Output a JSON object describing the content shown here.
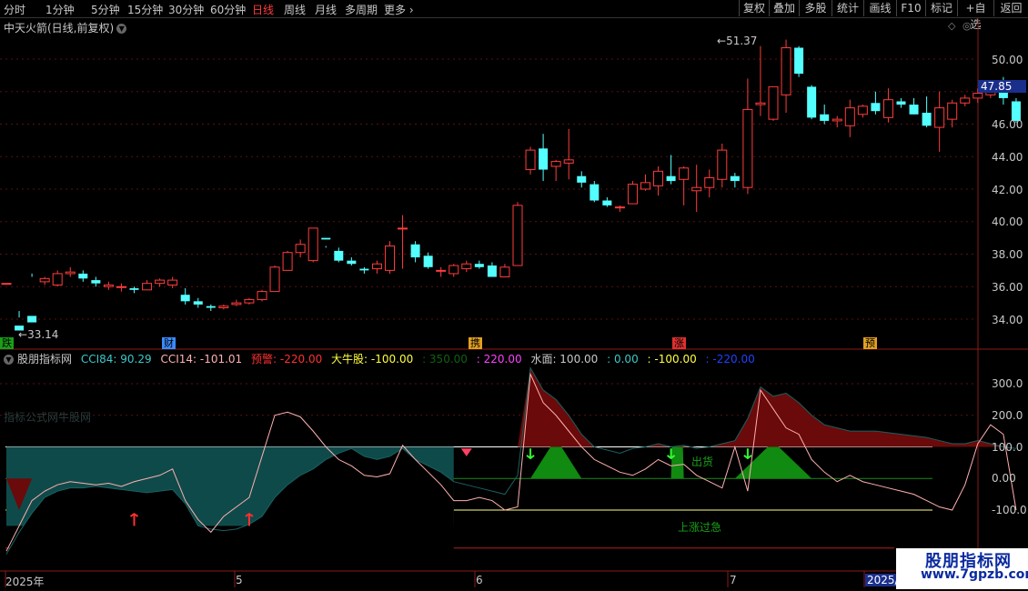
{
  "toolbar": {
    "tabs": [
      "分时",
      "1分钟",
      "5分钟",
      "15分钟",
      "30分钟",
      "60分钟",
      "日线",
      "周线",
      "月线",
      "多周期",
      "更多"
    ],
    "active_tab": "日线",
    "right_buttons": [
      "复权",
      "叠加",
      "多股",
      "统计",
      "画线",
      "F10",
      "标记",
      "+自选",
      "返回"
    ]
  },
  "chart_title": "中天火箭(日线,前复权)",
  "price_axis": [
    "50.00",
    "48.00",
    "46.00",
    "44.00",
    "42.00",
    "40.00",
    "38.00",
    "36.00",
    "34.00"
  ],
  "current_price": "47.85",
  "high_label": "51.37",
  "low_label": "33.14",
  "markers": [
    {
      "text": "跌",
      "color": "#18a018"
    },
    {
      "text": "财",
      "color": "#3a8cff"
    },
    {
      "text": "携",
      "color": "#e0a020"
    },
    {
      "text": "涨",
      "color": "#e03030"
    },
    {
      "text": "预",
      "color": "#e0a020"
    }
  ],
  "indicator": {
    "name": "股朋指标网",
    "values": [
      {
        "text": "CCI84: 90.29",
        "color": "#3cc8c8"
      },
      {
        "text": "CCI14: -101.01",
        "color": "#ffb0b0"
      },
      {
        "text": "预警: -220.00",
        "color": "#ff3030"
      },
      {
        "text": "大牛股: -100.00",
        "color": "#ffff40"
      },
      {
        "text": ": 350.00",
        "color": "#106010"
      },
      {
        "text": ": 220.00",
        "color": "#ff40ff"
      },
      {
        "text": "水面: 100.00",
        "color": "#c8c8c8"
      },
      {
        "text": ": 0.00",
        "color": "#3cc8c8"
      },
      {
        "text": ": -100.00",
        "color": "#ffff40"
      },
      {
        "text": ": -220.00",
        "color": "#2040ff"
      }
    ],
    "axis": [
      "300.0",
      "200.0",
      "100.0",
      "0.00",
      "-100.0"
    ],
    "faint_text": "指标公式网牛股网",
    "label_chuhuo": "出货",
    "label_guoji": "上涨过急"
  },
  "x_axis": [
    "2025年",
    "5",
    "6",
    "7",
    "2025/"
  ],
  "watermark": {
    "line1": "股朋指标网",
    "line2": "www.7gpzb.com"
  },
  "chart_data": {
    "type": "candlestick",
    "ylim": [
      33,
      52
    ],
    "candles": [
      [
        36.2,
        33.5,
        36.2,
        33.5
      ],
      [
        33.6,
        34.5,
        33.3,
        34.1
      ],
      [
        34.2,
        36.8,
        33.8,
        36.6
      ],
      [
        36.3,
        36.1,
        36.5,
        36.6
      ],
      [
        36.1,
        37.0,
        36.8,
        36.0
      ],
      [
        36.8,
        37.2,
        36.9,
        36.6
      ],
      [
        36.8,
        37.0,
        36.5,
        36.3
      ],
      [
        36.4,
        36.6,
        36.2,
        36.0
      ],
      [
        36.0,
        36.3,
        36.1,
        35.8
      ],
      [
        36.0,
        36.2,
        36.0,
        35.7
      ],
      [
        35.9,
        36.0,
        35.8,
        35.6
      ],
      [
        35.8,
        36.4,
        36.2,
        35.8
      ],
      [
        36.2,
        36.5,
        36.4,
        36.0
      ],
      [
        36.1,
        36.6,
        36.4,
        35.9
      ],
      [
        35.5,
        35.9,
        35.1,
        34.9
      ],
      [
        35.1,
        35.3,
        34.9,
        34.7
      ],
      [
        34.8,
        34.9,
        34.7,
        34.5
      ],
      [
        34.7,
        34.9,
        34.8,
        34.6
      ],
      [
        34.9,
        35.2,
        35.0,
        34.8
      ],
      [
        35.0,
        35.3,
        35.2,
        34.9
      ],
      [
        35.2,
        35.8,
        35.7,
        35.1
      ],
      [
        35.7,
        37.3,
        37.2,
        35.7
      ],
      [
        37.0,
        38.2,
        38.1,
        37.0
      ],
      [
        38.1,
        38.9,
        38.6,
        37.8
      ],
      [
        37.6,
        39.6,
        39.6,
        37.5
      ],
      [
        39.0,
        38.5,
        38.9,
        38.4
      ],
      [
        38.2,
        38.4,
        37.6,
        37.5
      ],
      [
        37.6,
        37.8,
        37.4,
        37.3
      ],
      [
        37.1,
        37.2,
        37.0,
        36.8
      ],
      [
        37.1,
        37.6,
        37.4,
        36.8
      ],
      [
        37.0,
        38.8,
        38.5,
        36.8
      ],
      [
        39.6,
        40.4,
        39.6,
        37.1
      ],
      [
        38.6,
        38.8,
        37.8,
        37.5
      ],
      [
        37.9,
        38.1,
        37.2,
        37.1
      ],
      [
        37.0,
        37.2,
        37.0,
        36.6
      ],
      [
        36.8,
        37.4,
        37.3,
        36.6
      ],
      [
        37.1,
        37.6,
        37.4,
        36.9
      ],
      [
        37.4,
        37.6,
        37.2,
        37.1
      ],
      [
        37.3,
        37.5,
        36.6,
        36.6
      ],
      [
        36.6,
        37.4,
        37.2,
        36.6
      ],
      [
        37.3,
        41.2,
        41.0,
        37.3
      ],
      [
        43.2,
        44.6,
        44.4,
        42.9
      ],
      [
        44.5,
        45.4,
        43.2,
        42.5
      ],
      [
        43.4,
        43.8,
        43.7,
        42.5
      ],
      [
        43.6,
        45.7,
        43.8,
        42.6
      ],
      [
        42.8,
        43.1,
        42.4,
        42.1
      ],
      [
        42.3,
        42.5,
        41.3,
        41.2
      ],
      [
        41.3,
        41.5,
        41.0,
        40.9
      ],
      [
        40.9,
        41.0,
        40.9,
        40.6
      ],
      [
        41.1,
        42.5,
        42.3,
        41.1
      ],
      [
        42.0,
        42.9,
        42.4,
        41.9
      ],
      [
        42.2,
        43.4,
        43.1,
        41.6
      ],
      [
        42.8,
        44.1,
        42.5,
        42.3
      ],
      [
        42.6,
        43.4,
        43.3,
        41.0
      ],
      [
        41.9,
        43.5,
        42.1,
        40.6
      ],
      [
        42.1,
        43.2,
        42.7,
        41.5
      ],
      [
        42.6,
        44.8,
        44.4,
        42.1
      ],
      [
        42.8,
        43.0,
        42.5,
        42.1
      ],
      [
        42.1,
        48.8,
        46.9,
        41.7
      ],
      [
        47.2,
        50.8,
        47.3,
        46.5
      ],
      [
        46.3,
        48.3,
        48.3,
        46.2
      ],
      [
        47.8,
        51.2,
        50.7,
        46.7
      ],
      [
        50.7,
        50.8,
        49.1,
        48.9
      ],
      [
        48.3,
        48.4,
        46.4,
        46.3
      ],
      [
        46.6,
        47.2,
        46.2,
        46.0
      ],
      [
        46.2,
        46.5,
        46.3,
        45.8
      ],
      [
        45.9,
        47.5,
        47.0,
        45.2
      ],
      [
        46.6,
        47.2,
        47.1,
        46.4
      ],
      [
        47.3,
        48.0,
        46.8,
        46.6
      ],
      [
        46.4,
        48.2,
        47.5,
        46.1
      ],
      [
        47.4,
        47.6,
        47.2,
        47.0
      ],
      [
        47.2,
        47.6,
        46.6,
        46.6
      ],
      [
        46.7,
        47.7,
        45.9,
        45.8
      ],
      [
        45.8,
        48.0,
        47.0,
        44.3
      ],
      [
        46.3,
        47.5,
        47.3,
        45.8
      ],
      [
        47.3,
        47.8,
        47.6,
        47.1
      ],
      [
        47.6,
        48.2,
        47.9,
        47.3
      ],
      [
        47.8,
        48.5,
        48.2,
        47.6
      ],
      [
        48.1,
        48.9,
        47.6,
        47.2
      ],
      [
        47.4,
        47.6,
        46.2,
        46.1
      ]
    ]
  }
}
